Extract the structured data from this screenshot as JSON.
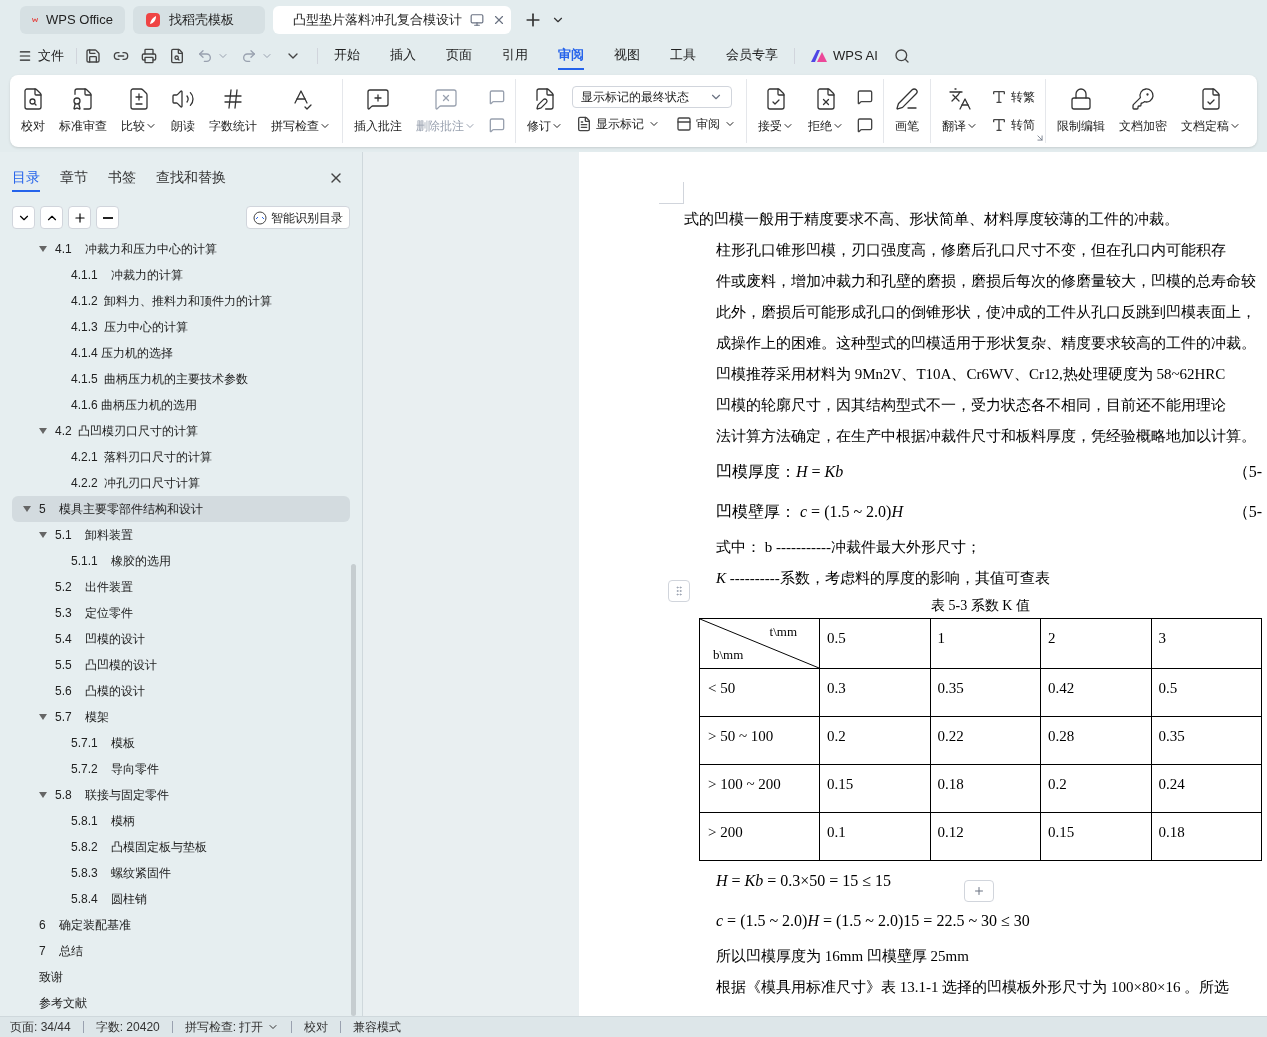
{
  "window_tabs": [
    {
      "kind": "wps",
      "label": "WPS Office",
      "selected": false
    },
    {
      "kind": "template",
      "label": "找稻壳模板",
      "selected": false
    },
    {
      "kind": "doc",
      "label": "凸型垫片落料冲孔复合模设计",
      "selected": true
    }
  ],
  "menu": {
    "file": "文件",
    "tabs": [
      {
        "label": "开始",
        "selected": false
      },
      {
        "label": "插入",
        "selected": false
      },
      {
        "label": "页面",
        "selected": false
      },
      {
        "label": "引用",
        "selected": false
      },
      {
        "label": "审阅",
        "selected": true
      },
      {
        "label": "视图",
        "selected": false
      },
      {
        "label": "工具",
        "selected": false
      },
      {
        "label": "会员专享",
        "selected": false
      }
    ],
    "ai": "WPS AI"
  },
  "ribbon": [
    {
      "items": [
        {
          "kind": "large",
          "label": "校对",
          "dropdown": false,
          "disabled": false
        },
        {
          "kind": "large",
          "label": "标准审查",
          "dropdown": false,
          "disabled": false
        },
        {
          "kind": "large",
          "label": "比较",
          "dropdown": true,
          "disabled": false
        },
        {
          "kind": "large",
          "label": "朗读",
          "dropdown": false,
          "disabled": false
        },
        {
          "kind": "large",
          "label": "字数统计",
          "dropdown": false,
          "disabled": false
        },
        {
          "kind": "large",
          "label": "拼写检查",
          "dropdown": true,
          "disabled": false
        }
      ]
    },
    {
      "items": [
        {
          "kind": "large",
          "label": "插入批注",
          "dropdown": false,
          "disabled": false
        },
        {
          "kind": "large",
          "label": "删除批注",
          "dropdown": true,
          "disabled": true
        },
        {
          "kind": "stack",
          "rows": [
            {
              "kind": "buttons",
              "buttons": [
                {
                  "dropdown": false,
                  "disabled": true
                }
              ]
            },
            {
              "kind": "buttons",
              "buttons": [
                {
                  "dropdown": false,
                  "disabled": true
                }
              ]
            }
          ]
        }
      ]
    },
    {
      "items": [
        {
          "kind": "large",
          "label": "修订",
          "dropdown": true,
          "disabled": false
        },
        {
          "kind": "stack",
          "rows": [
            {
              "kind": "select",
              "value": "显示标记的最终状态"
            },
            {
              "kind": "buttons",
              "buttons": [
                {
                  "label": "显示标记",
                  "dropdown": true,
                  "disabled": false
                },
                {
                  "label": "审阅",
                  "dropdown": true,
                  "disabled": false
                }
              ]
            }
          ]
        }
      ]
    },
    {
      "items": [
        {
          "kind": "large",
          "label": "接受",
          "dropdown": true,
          "disabled": false
        },
        {
          "kind": "large",
          "label": "拒绝",
          "dropdown": true,
          "disabled": false
        },
        {
          "kind": "stack",
          "rows": [
            {
              "kind": "buttons",
              "buttons": [
                {
                  "dropdown": false,
                  "disabled": false
                }
              ]
            },
            {
              "kind": "buttons",
              "buttons": [
                {
                  "dropdown": false,
                  "disabled": false
                }
              ]
            }
          ]
        }
      ]
    },
    {
      "items": [
        {
          "kind": "large",
          "label": "画笔",
          "dropdown": false,
          "disabled": false
        }
      ]
    },
    {
      "launcher": true,
      "items": [
        {
          "kind": "large",
          "label": "翻译",
          "dropdown": true,
          "disabled": false
        },
        {
          "kind": "stack",
          "rows": [
            {
              "kind": "buttons",
              "buttons": [
                {
                  "label": "转繁",
                  "dropdown": false,
                  "disabled": false
                }
              ]
            },
            {
              "kind": "buttons",
              "buttons": [
                {
                  "label": "转简",
                  "dropdown": false,
                  "disabled": false
                }
              ]
            }
          ]
        }
      ]
    },
    {
      "items": [
        {
          "kind": "large",
          "label": "限制编辑",
          "dropdown": false,
          "disabled": false
        },
        {
          "kind": "large",
          "label": "文档加密",
          "dropdown": false,
          "disabled": false
        },
        {
          "kind": "large",
          "label": "文档定稿",
          "dropdown": true,
          "disabled": false
        }
      ]
    }
  ],
  "sidebar": {
    "tabs": [
      {
        "label": "目录",
        "selected": true
      },
      {
        "label": "章节",
        "selected": false
      },
      {
        "label": "书签",
        "selected": false
      },
      {
        "label": "查找和替换",
        "selected": false
      }
    ],
    "smart_button": "智能识别目录",
    "toc": [
      {
        "children": [
          {
            "label": "4.1    冲裁力和压力中心的计算",
            "expanded": true,
            "selected": false,
            "children": [
              {
                "label": "4.1.1    冲裁力的计算",
                "selected": false
              },
              {
                "label": "4.1.2  卸料力、推料力和顶件力的计算",
                "selected": false
              },
              {
                "label": "4.1.3  压力中心的计算",
                "selected": false
              },
              {
                "label": "4.1.4 压力机的选择",
                "selected": false
              },
              {
                "label": "4.1.5  曲柄压力机的主要技术参数",
                "selected": false
              },
              {
                "label": "4.1.6 曲柄压力机的选用",
                "selected": false
              }
            ]
          },
          {
            "label": "4.2  凸凹模刃口尺寸的计算",
            "expanded": true,
            "selected": false,
            "children": [
              {
                "label": "4.2.1  落料刃口尺寸的计算",
                "selected": false
              },
              {
                "label": "4.2.2  冲孔刃口尺寸计算",
                "selected": false
              }
            ]
          }
        ]
      },
      {
        "label": "5    模具主要零部件结构和设计",
        "expanded": true,
        "selected": true,
        "children": [
          {
            "label": "5.1    卸料装置",
            "expanded": true,
            "selected": false,
            "children": [
              {
                "label": "5.1.1    橡胶的选用",
                "selected": false
              }
            ]
          },
          {
            "label": "5.2    出件装置",
            "selected": false
          },
          {
            "label": "5.3    定位零件",
            "selected": false
          },
          {
            "label": "5.4    凹模的设计",
            "selected": false
          },
          {
            "label": "5.5    凸凹模的设计",
            "selected": false
          },
          {
            "label": "5.6    凸模的设计",
            "selected": false
          },
          {
            "label": "5.7    模架",
            "expanded": true,
            "selected": false,
            "children": [
              {
                "label": "5.7.1    模板",
                "selected": false
              },
              {
                "label": "5.7.2    导向零件",
                "selected": false
              }
            ]
          },
          {
            "label": "5.8    联接与固定零件",
            "expanded": true,
            "selected": false,
            "children": [
              {
                "label": "5.8.1    模柄",
                "selected": false
              },
              {
                "label": "5.8.2    凸模固定板与垫板",
                "selected": false
              },
              {
                "label": "5.8.3    螺纹紧固件",
                "selected": false
              },
              {
                "label": "5.8.4    圆柱销",
                "selected": false
              }
            ]
          }
        ]
      },
      {
        "label": "6    确定装配基准",
        "selected": false
      },
      {
        "label": "7    总结",
        "selected": false
      },
      {
        "label": "致谢",
        "selected": false
      },
      {
        "label": "参考文献",
        "selected": false
      }
    ]
  },
  "document": [
    {
      "kind": "text",
      "indent": false,
      "lines": [
        "式的凹模一般用于精度要求不高、形状简单、材料厚度较薄的工件的冲裁。"
      ]
    },
    {
      "kind": "text",
      "indent": true,
      "lines": [
        "柱形孔口锥形凹模，刃口强度高，修磨后孔口尺寸不变，但在孔口内可能积存",
        "件或废料，增加冲裁力和孔壁的磨损，磨损后每次的修磨量较大，凹模的总寿命较",
        "此外，磨损后可能形成孔口的倒锥形状，使冲成的工件从孔口反跳到凹模表面上，",
        "成操作上的困难。这种型式的凹模适用于形状复杂、精度要求较高的工件的冲裁。"
      ]
    },
    {
      "kind": "text",
      "indent": true,
      "lines": [
        "凹模推荐采用材料为 9Mn2V、T10A、Cr6WV、Cr12,热处理硬度为 58~62HRC"
      ]
    },
    {
      "kind": "text",
      "indent": true,
      "lines": [
        "凹模的轮廓尺寸，因其结构型式不一，受力状态各不相同，目前还不能用理论",
        "法计算方法确定，在生产中根据冲裁件尺寸和板料厚度，凭经验概略地加以计算。"
      ]
    },
    {
      "kind": "formula",
      "text": "凹模厚度：*H* = *Kb*",
      "number": "（5-"
    },
    {
      "kind": "formula",
      "text": "凹模壁厚： *c* = (1.5 ~ 2.0)*H*",
      "number": "（5-"
    },
    {
      "kind": "text",
      "indent": true,
      "lines": [
        "式中：   b -----------冲裁件最大外形尺寸；"
      ]
    },
    {
      "kind": "text",
      "indent": true,
      "lines": [
        "*K* ----------系数，考虑料的厚度的影响，其值可查表"
      ]
    },
    {
      "kind": "table",
      "caption": "表 5-3  系数 K 值",
      "corner_top": "t\\mm",
      "corner_bottom": "b\\mm",
      "columns": [
        "0.5",
        "1",
        "2",
        "3"
      ],
      "rows": [
        {
          "label": "< 50",
          "cells": [
            "0.3",
            "0.35",
            "0.42",
            "0.5"
          ]
        },
        {
          "label": "> 50 ~ 100",
          "cells": [
            "0.2",
            "0.22",
            "0.28",
            "0.35"
          ]
        },
        {
          "label": "> 100 ~ 200",
          "cells": [
            "0.15",
            "0.18",
            "0.2",
            "0.24"
          ]
        },
        {
          "label": "> 200",
          "cells": [
            "0.1",
            "0.12",
            "0.15",
            "0.18"
          ]
        }
      ]
    },
    {
      "kind": "formula",
      "text": "*H* = *Kb* = 0.3×50 = 15 ≤ 15"
    },
    {
      "kind": "formula",
      "text": "*c* = (1.5 ~ 2.0)*H* = (1.5 ~ 2.0)15 = 22.5 ~ 30 ≤ 30"
    },
    {
      "kind": "text",
      "indent": true,
      "lines": [
        "所以凹模厚度为 16mm 凹模壁厚 25mm"
      ]
    },
    {
      "kind": "text",
      "indent": true,
      "lines": [
        "根据《模具用标准尺寸》表 13.1-1 选择的凹模板外形尺寸为 100×80×16 。所选"
      ]
    }
  ],
  "status_bar": [
    {
      "label": "页面: 34/44",
      "dropdown": false
    },
    {
      "label": "字数: 20420",
      "dropdown": false
    },
    {
      "label": "拼写检查: 打开",
      "dropdown": true
    },
    {
      "label": "校对",
      "dropdown": false
    },
    {
      "label": "兼容模式",
      "dropdown": false
    }
  ]
}
